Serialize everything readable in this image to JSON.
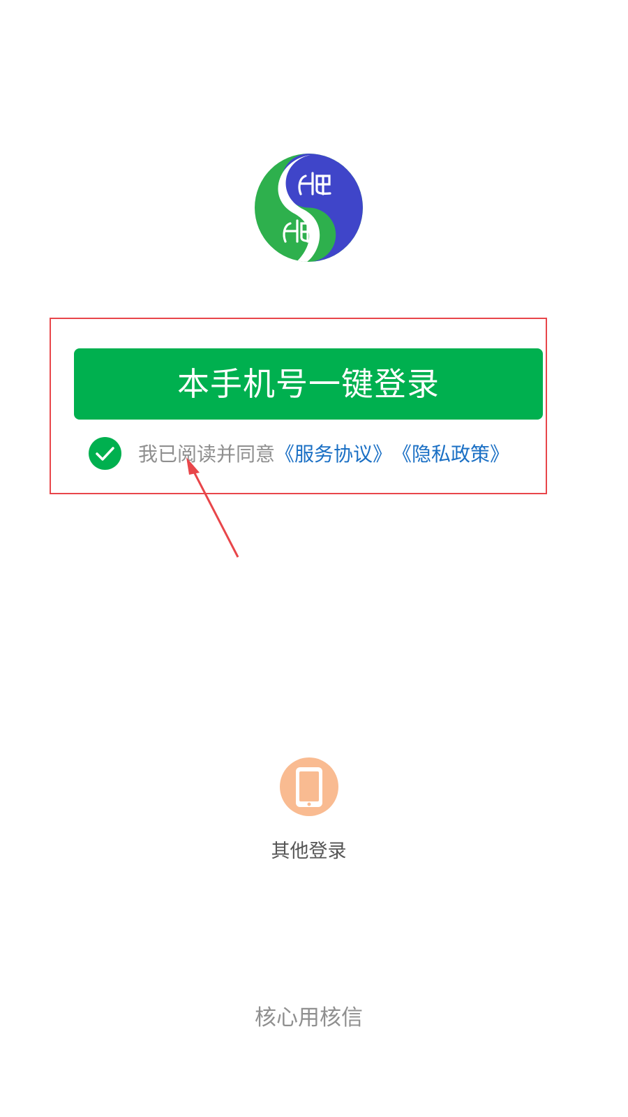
{
  "login": {
    "one_click_label": "本手机号一键登录"
  },
  "agreement": {
    "prefix": "我已阅读并同意",
    "service_link": "《服务协议》",
    "privacy_link": "《隐私政策》",
    "checked": true
  },
  "other_login": {
    "label": "其他登录",
    "icon": "phone-icon"
  },
  "footer": {
    "text": "核心用核信"
  },
  "colors": {
    "primary_green": "#00b04f",
    "link_blue": "#1a6fc4",
    "annotation_red": "#e8464a",
    "other_login_orange": "#f9bb91",
    "logo_green": "#2eb04d",
    "logo_blue": "#3f45c9"
  }
}
